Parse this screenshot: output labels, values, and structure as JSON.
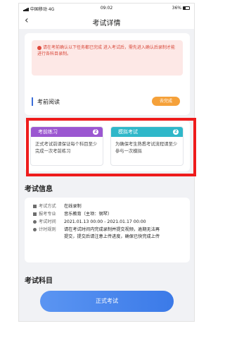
{
  "status_bar": {
    "carrier": "中国移动 4G",
    "time": "09:02",
    "battery": "36%"
  },
  "nav": {
    "back_icon": "chevron-left-icon",
    "title": "考试详情"
  },
  "notice": {
    "icon": "alert-circle-icon",
    "text": "请在考前确认以下任务都已完成 进入考试后，需先进入确认后录制才能进行各科目录制。"
  },
  "pre_reading": {
    "label": "考前阅读",
    "status": "去完成"
  },
  "practice": {
    "mock_practice": {
      "title": "考前练习",
      "badge": "2",
      "desc": "正式考试前请保证每个科目至少完成一次考前练习"
    },
    "simulation": {
      "title": "模拟考试",
      "badge": "2",
      "desc": "为确保考生熟悉考试流程请至少参与一次模拟"
    }
  },
  "exam_info": {
    "title": "考试信息",
    "rows": [
      {
        "icon": "grid-icon",
        "key": "考试方式",
        "value": "在线录制"
      },
      {
        "icon": "bar-chart-icon",
        "key": "报考专业",
        "value": "音乐教育（主项：钢琴）"
      },
      {
        "icon": "clock-icon",
        "key": "考试时间",
        "value": "2021.01.13 00:00 - 2021.01.17 00:00"
      },
      {
        "icon": "timer-icon",
        "key": "计时规则",
        "value": "请在考试时间内完成录制并提交视频，逾期无法再提交，提交后请注意上传进度，确保已快完成上传"
      }
    ]
  },
  "subjects": {
    "title": "考试科目",
    "button": "正式考试"
  },
  "colors": {
    "highlight": "#ee1c1c",
    "purple": "#9b57d1",
    "teal": "#2fb7c9",
    "orange": "#f5a13a",
    "blue": "#3b7ae8"
  }
}
